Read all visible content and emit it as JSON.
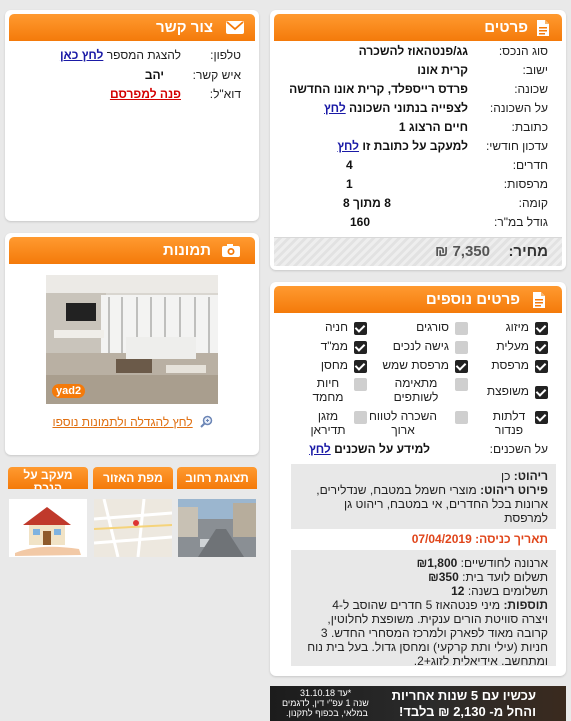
{
  "details": {
    "title": "פרטים",
    "rows": [
      {
        "label": "סוג הנכס:",
        "value": "גג/פנטהאוז להשכרה"
      },
      {
        "label": "ישוב:",
        "value": "קרית אונו"
      },
      {
        "label": "שכונה:",
        "value": "פרדס רייספלד, קרית אונו החדשה"
      },
      {
        "label": "על השכונה:",
        "value": "לצפייה בנתוני השכונה",
        "link": "לחץ"
      },
      {
        "label": "כתובת:",
        "value": "חיים הרצוג 1"
      },
      {
        "label": "עדכון חודשי:",
        "value": "למעקב על כתובת זו",
        "link": "לחץ"
      },
      {
        "label": "חדרים:",
        "value": "4"
      },
      {
        "label": "מרפסות:",
        "value": "1"
      },
      {
        "label": "קומה:",
        "value": "8 מתוך 8"
      },
      {
        "label": "גודל במ\"ר:",
        "value": "160"
      }
    ],
    "price_label": "מחיר:",
    "price_value": "7,350 ₪"
  },
  "contact": {
    "title": "צור קשר",
    "phone_label": "טלפון:",
    "phone_text": "להצגת המספר",
    "phone_link": "לחץ כאן",
    "person_label": "איש קשר:",
    "person_value": "יהב",
    "email_label": "דוא\"ל:",
    "email_link": "פנה למפרסם"
  },
  "photos": {
    "title": "תמונות",
    "watermark": "yad2",
    "more_link": "לחץ להגדלה ולתמונות נוספו"
  },
  "tabs": [
    {
      "label": "תצוגת רחוב"
    },
    {
      "label": "מפת האזור"
    },
    {
      "label": "מעקב על הנכס"
    }
  ],
  "extra": {
    "title": "פרטים נוספים",
    "features": [
      {
        "label": "מיזוג",
        "on": true
      },
      {
        "label": "סורגים",
        "on": false
      },
      {
        "label": "חניה",
        "on": true
      },
      {
        "label": "מעלית",
        "on": true
      },
      {
        "label": "גישה לנכים",
        "on": false
      },
      {
        "label": "ממ\"ד",
        "on": true
      },
      {
        "label": "מרפסת",
        "on": true
      },
      {
        "label": "מרפסת שמש",
        "on": true
      },
      {
        "label": "מחסן",
        "on": true
      },
      {
        "label": "משופצת",
        "on": true
      },
      {
        "label": "מתאימה לשותפים",
        "on": false
      },
      {
        "label": "חיות מחמד",
        "on": false
      },
      {
        "label": "דלתות פנדור",
        "on": true
      },
      {
        "label": "השכרה לטווח ארוך",
        "on": false
      },
      {
        "label": "מזגן תדיראן",
        "on": false
      }
    ],
    "neighbors_label": "על השכנים:",
    "neighbors_text": "למידע על השכנים",
    "neighbors_link": "לחץ"
  },
  "info": {
    "furniture_label": "ריהוט:",
    "furniture_value": "כן",
    "furniture_detail_label": "פירוט ריהוט:",
    "furniture_detail_value": "מוצרי חשמל במטבח, שנדלירים, ארונות בכל החדרים, אי במטבח, ריהוט גן למרפסת",
    "entry_label": "תאריך כניסה:",
    "entry_value": "07/04/2019",
    "arnona_label": "ארנונה לחודשיים:",
    "arnona_value": "₪1,800",
    "vaad_label": "תשלום לועד בית:",
    "vaad_value": "₪350",
    "payments_label": "תשלומים בשנה:",
    "payments_value": "12",
    "notes_label": "תוספות:",
    "notes_value": "מיני פנטהאוז 5 חדרים שהוסב ל-4 ויצרה סוויטת הורים ענקית. משופצת לחלוטין, קרובה מאוד לפארק ולמרכז המסחרי החדש. 3 חניות (עילי ותת קרקעי) ומחסן גדול. בעל בית נוח ומתחשב. אידיאלית לזוג+2."
  },
  "ad": {
    "line1": "עכשיו עם 5 שנות אחריות",
    "line2": "והחל מ- 2,130 ₪ בלבד!",
    "small1": "*עד 31.10.18",
    "small2": "שנה 1 עפ\"י דין, לדגמים",
    "small3": "במלאי, בכפוף לתקנון."
  },
  "colors": {
    "accent": "#f47a0a",
    "link": "#1a1aa6",
    "date": "#e0451a"
  }
}
